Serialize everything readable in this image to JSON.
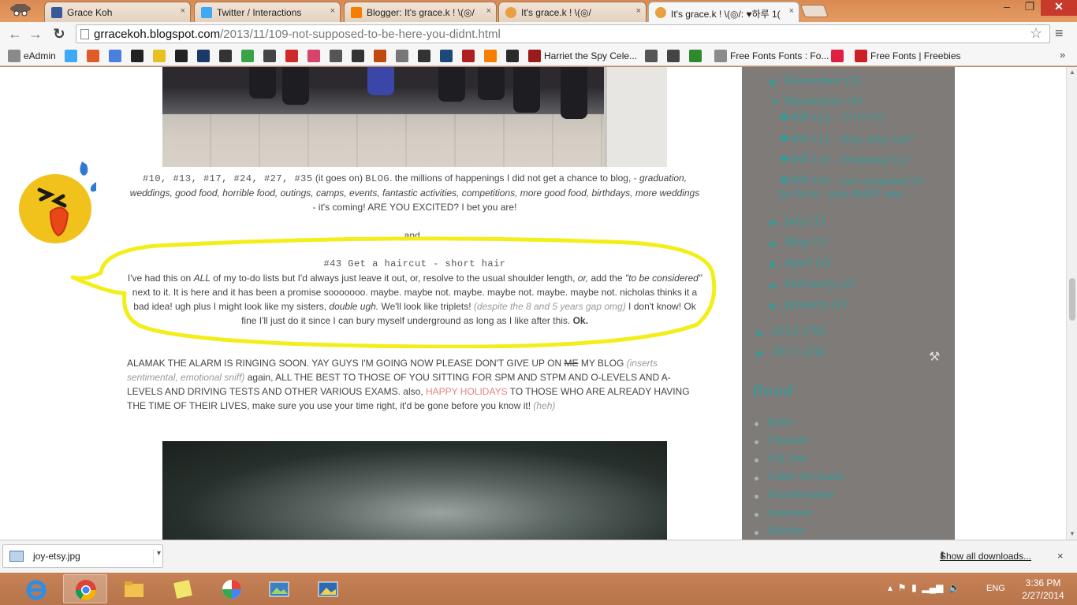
{
  "browser": {
    "tabs": [
      {
        "label": "Grace Koh",
        "favicon_color": "#3b5998",
        "active": false
      },
      {
        "label": "Twitter / Interactions",
        "favicon_color": "#3fa9f5",
        "active": false
      },
      {
        "label": "Blogger: It's grace.k ! \\(◎/",
        "favicon_color": "#f57d00",
        "active": false
      },
      {
        "label": "It's grace.k ! \\(◎/",
        "favicon_color": "#e8a040",
        "active": false
      },
      {
        "label": "It's grace.k ! \\(◎/: ♥하루 1(",
        "favicon_color": "#e8a040",
        "active": true
      }
    ],
    "tab_close_glyph": "×",
    "address": {
      "host": "grracekoh.blogspot.com",
      "path": "/2013/11/109-not-supposed-to-be-here-you-didnt.html"
    },
    "bookmarks": [
      {
        "label": "eAdmin",
        "icon": "page-icon",
        "color": "#8a8a8a"
      },
      {
        "label": "",
        "icon": "twitter-icon",
        "color": "#3fa9f5"
      },
      {
        "label": "",
        "icon": "windows-icon",
        "color": "#e05a2a"
      },
      {
        "label": "",
        "icon": "google-icon",
        "color": "#4a7fe0"
      },
      {
        "label": "",
        "icon": "c-icon",
        "color": "#222222"
      },
      {
        "label": "",
        "icon": "yellow-icon",
        "color": "#e8c020"
      },
      {
        "label": "",
        "icon": "g-icon",
        "color": "#222222"
      },
      {
        "label": "",
        "icon": "square-icon",
        "color": "#1b3a6b"
      },
      {
        "label": "",
        "icon": "car-icon",
        "color": "#333333"
      },
      {
        "label": "",
        "icon": "h-icon",
        "color": "#3aa34a"
      },
      {
        "label": "",
        "icon": "bottle-icon",
        "color": "#444444"
      },
      {
        "label": "",
        "icon": "a-icon",
        "color": "#d02b2b"
      },
      {
        "label": "",
        "icon": "heart-circle-icon",
        "color": "#d8436a"
      },
      {
        "label": "",
        "icon": "wsj-icon",
        "color": "#555555"
      },
      {
        "label": "",
        "icon": "clock-icon",
        "color": "#333333"
      },
      {
        "label": "",
        "icon": "a2-icon",
        "color": "#c04a10"
      },
      {
        "label": "",
        "icon": "b-icon",
        "color": "#777777"
      },
      {
        "label": "",
        "icon": "asterisk-icon",
        "color": "#333333"
      },
      {
        "label": "",
        "icon": "bi-icon",
        "color": "#1b4a7a"
      },
      {
        "label": "",
        "icon": "r-icon",
        "color": "#b02020"
      },
      {
        "label": "",
        "icon": "blogger-icon",
        "color": "#f57d00"
      },
      {
        "label": "",
        "icon": "sun-icon",
        "color": "#2a2a2a"
      },
      {
        "label": "",
        "icon": "heart-icon",
        "color": "#b8a010"
      },
      {
        "label": "Harriet the Spy Cele...",
        "icon": "hs-icon",
        "color": "#9a1b1b"
      },
      {
        "label": "",
        "icon": "bird-icon",
        "color": "#555555"
      },
      {
        "label": "",
        "icon": "heart-dark-icon",
        "color": "#444444"
      },
      {
        "label": "",
        "icon": "green-icon",
        "color": "#2d8a2d"
      },
      {
        "label": "Free Fonts Fonts : Fo...",
        "icon": "page-icon",
        "color": "#8a8a8a"
      },
      {
        "label": "",
        "icon": "heart-red-icon",
        "color": "#e02040"
      },
      {
        "label": "Free Fonts | Freebies",
        "icon": "pinterest-icon",
        "color": "#cb2027"
      }
    ],
    "bookmarks_more": "»"
  },
  "post": {
    "tags_line": "#10, #13, #17, #24, #27, #35",
    "tags_suffix": " (it goes on) ",
    "blog_word": "BLOG",
    "tags_rest": ". the millions of happenings I did not get a chance to blog, - ",
    "tags_italic": "graduation, weddings, good food, horrible food, outings, camps, events, fantastic activities, competitions, more good food, birthdays, more weddings",
    "tags_end": " - it's coming! ARE YOU EXCITED? I bet you are!",
    "and_line": "and..",
    "haircut_title": "#43 Get a haircut - short hair",
    "haircut_p1": "I've had this on ",
    "haircut_all": "ALL",
    "haircut_p2": " of my to-do lists but I'd always just leave it out, or, resolve to the usual shoulder length, ",
    "haircut_or": "or,",
    "haircut_p3": " add the ",
    "haircut_quote": "\"to be considered\"",
    "haircut_p4": " next to it. It is here and it has been a promise sooooooo. maybe. maybe not. maybe. maybe not. maybe. maybe not. nicholas thinks it a bad idea! ugh plus I might look like my sisters, ",
    "haircut_double": "double ugh.",
    "haircut_p5": " We'll look like triplets! ",
    "haircut_grey": "(despite the 8 and 5 years gap omg)",
    "haircut_p6": " I don't know! Ok fine I'll just do it since I can bury myself underground as long as I like after this. ",
    "haircut_ok": "Ok.",
    "alamak_p1": "ALAMAK THE ALARM IS RINGING SOON. YAY GUYS I'M GOING NOW PLEASE DON'T GIVE UP ON ",
    "alamak_me": "ME",
    "alamak_p2": " MY BLOG ",
    "alamak_grey1": "(inserts sentimental, emotional sniff)",
    "alamak_p3": " again, ALL THE BEST TO THOSE OF YOU SITTING FOR SPM AND STPM AND O-LEVELS AND A-LEVELS AND DRIVING TESTS AND OTHER VARIOUS EXAMS. also, ",
    "alamak_pink": "HAPPY HOLIDAYS",
    "alamak_p4": " TO THOSE WHO ARE ALREADY HAVING THE TIME OF THEIR LIVES, make sure you use your time right, it'd be gone before you know it! ",
    "alamak_grey2": "(heh)"
  },
  "sidebar": {
    "archive": [
      {
        "label": "December",
        "count": "(3)",
        "expanded": false
      },
      {
        "label": "November",
        "count": "(4)",
        "expanded": true
      },
      {
        "label": "July",
        "count": "(1)",
        "expanded": false
      },
      {
        "label": "May",
        "count": "(1)",
        "expanded": false
      },
      {
        "label": "April",
        "count": "(2)",
        "expanded": false
      },
      {
        "label": "February",
        "count": "(2)",
        "expanded": false
      },
      {
        "label": "January",
        "count": "(2)",
        "expanded": false
      },
      {
        "label": "2012",
        "count": "(76)",
        "expanded": false
      },
      {
        "label": "2011",
        "count": "(24)",
        "expanded": false
      }
    ],
    "november_posts": [
      "♥하루 112 - !!!!!!!!!!!",
      "♥하루 111 - Hey, why not?",
      "♥하루 110 - dropping by♪",
      "♥하루 109 - not supposed to be here - you didn't see..."
    ],
    "read_heading": "Read",
    "read_links": [
      "Belle",
      "Cheesie",
      "Chi Yan",
      "Color me katie",
      "Fourfeetnine",
      "Joyceeet",
      "Shirlyn"
    ]
  },
  "downloads": {
    "file_name": "joy-etsy.jpg",
    "show_all": "Show all downloads...",
    "close": "×"
  },
  "taskbar": {
    "apps": [
      "internet-explorer",
      "chrome",
      "file-explorer",
      "sticky-notes",
      "picasa",
      "photo-viewer",
      "photos"
    ],
    "language": "ENG",
    "time": "3:36 PM",
    "date": "2/27/2014"
  },
  "colors": {
    "link_teal": "#2e9e9c",
    "sidebar_bg": "#7f7b78",
    "titlebar": "#d98a52",
    "highlight_yellow": "#f3ee1a"
  }
}
